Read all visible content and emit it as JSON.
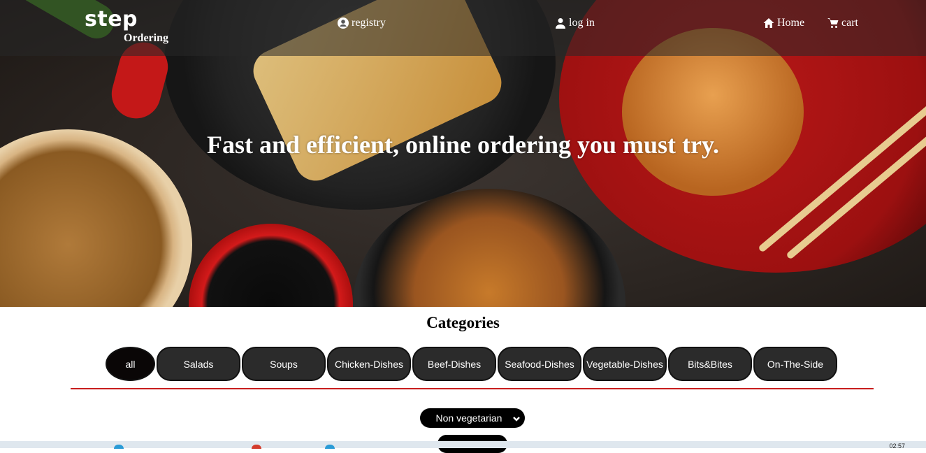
{
  "header": {
    "logo_main": "step",
    "logo_sub": "Ordering",
    "nav": {
      "registry": "registry",
      "login": "log in",
      "home": "Home",
      "cart": "cart"
    }
  },
  "hero": {
    "title": "Fast and efficient, online ordering you must try."
  },
  "categories": {
    "heading": "Categories",
    "items": [
      "all",
      "Salads",
      "Soups",
      "Chicken-Dishes",
      "Beef-Dishes",
      "Seafood-Dishes",
      "Vegetable-Dishes",
      "Bits&Bites",
      "On-The-Side"
    ],
    "active": "all"
  },
  "filter": {
    "selected": "Non vegetarian"
  },
  "taskbar": {
    "clock": "02:57"
  },
  "colors": {
    "divider": "#c81e1e",
    "button_bg": "#2b2b2b",
    "active_bg": "#0a0606"
  }
}
